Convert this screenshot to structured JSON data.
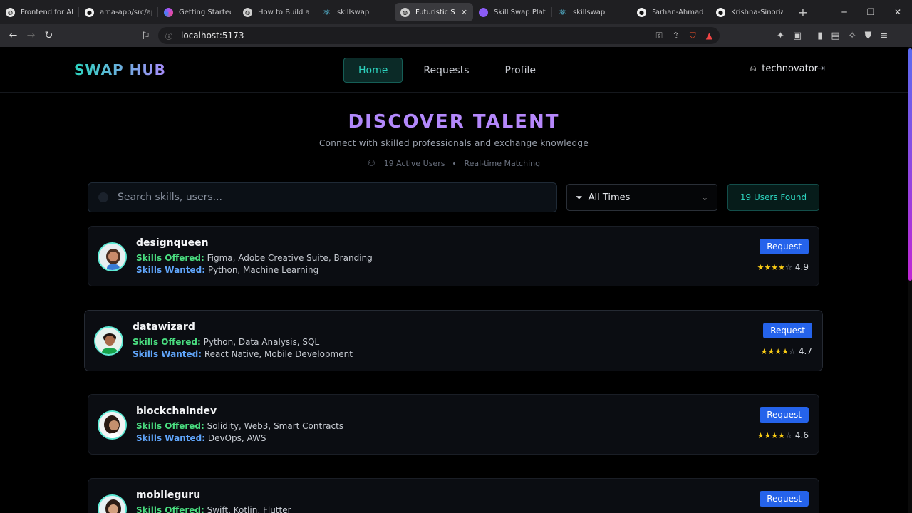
{
  "browser": {
    "tabs": [
      {
        "title": "Frontend for AI",
        "icon": "globe-icon",
        "color": "#ffffff"
      },
      {
        "title": "ama-app/src/ap",
        "icon": "github-icon",
        "color": "#ffffff"
      },
      {
        "title": "Getting Started",
        "icon": "colorful-app-icon",
        "color": "#a855f7"
      },
      {
        "title": "How to Build a",
        "icon": "globe-icon",
        "color": "#cccccc"
      },
      {
        "title": "skillswap",
        "icon": "react-icon",
        "color": "#61dafb"
      },
      {
        "title": "Futuristic S",
        "icon": "globe-icon",
        "color": "#cccccc",
        "active": true
      },
      {
        "title": "Skill Swap Platf",
        "icon": "app-icon",
        "color": "#8b5cf6"
      },
      {
        "title": "skillswap",
        "icon": "react-icon",
        "color": "#61dafb"
      },
      {
        "title": "Farhan-Ahmad",
        "icon": "github-icon",
        "color": "#ffffff"
      },
      {
        "title": "Krishna-Sinoria",
        "icon": "github-icon",
        "color": "#ffffff"
      }
    ],
    "url": "localhost:5173"
  },
  "nav": {
    "brand": "SWAP HUB",
    "links": [
      "Home",
      "Requests",
      "Profile"
    ],
    "username": "technovator"
  },
  "hero": {
    "title": "DISCOVER TALENT",
    "subtitle": "Connect with skilled professionals and exchange knowledge",
    "active_users": "19 Active Users",
    "matching": "Real-time Matching"
  },
  "search": {
    "placeholder": "Search skills, users...",
    "filter_value": "All Times",
    "found": "19 Users Found"
  },
  "labels": {
    "offered": "Skills Offered:",
    "wanted": "Skills Wanted:",
    "request": "Request"
  },
  "users": [
    {
      "name": "designqueen",
      "offered": "Figma, Adobe Creative Suite, Branding",
      "wanted": "Python, Machine Learning",
      "rating": "4.9",
      "stars": 4
    },
    {
      "name": "datawizard",
      "offered": "Python, Data Analysis, SQL",
      "wanted": "React Native, Mobile Development",
      "rating": "4.7",
      "stars": 4
    },
    {
      "name": "blockchaindev",
      "offered": "Solidity, Web3, Smart Contracts",
      "wanted": "DevOps, AWS",
      "rating": "4.6",
      "stars": 4
    },
    {
      "name": "mobileguru",
      "offered": "Swift, Kotlin, Flutter",
      "wanted": "",
      "rating": "",
      "stars": 0
    }
  ]
}
